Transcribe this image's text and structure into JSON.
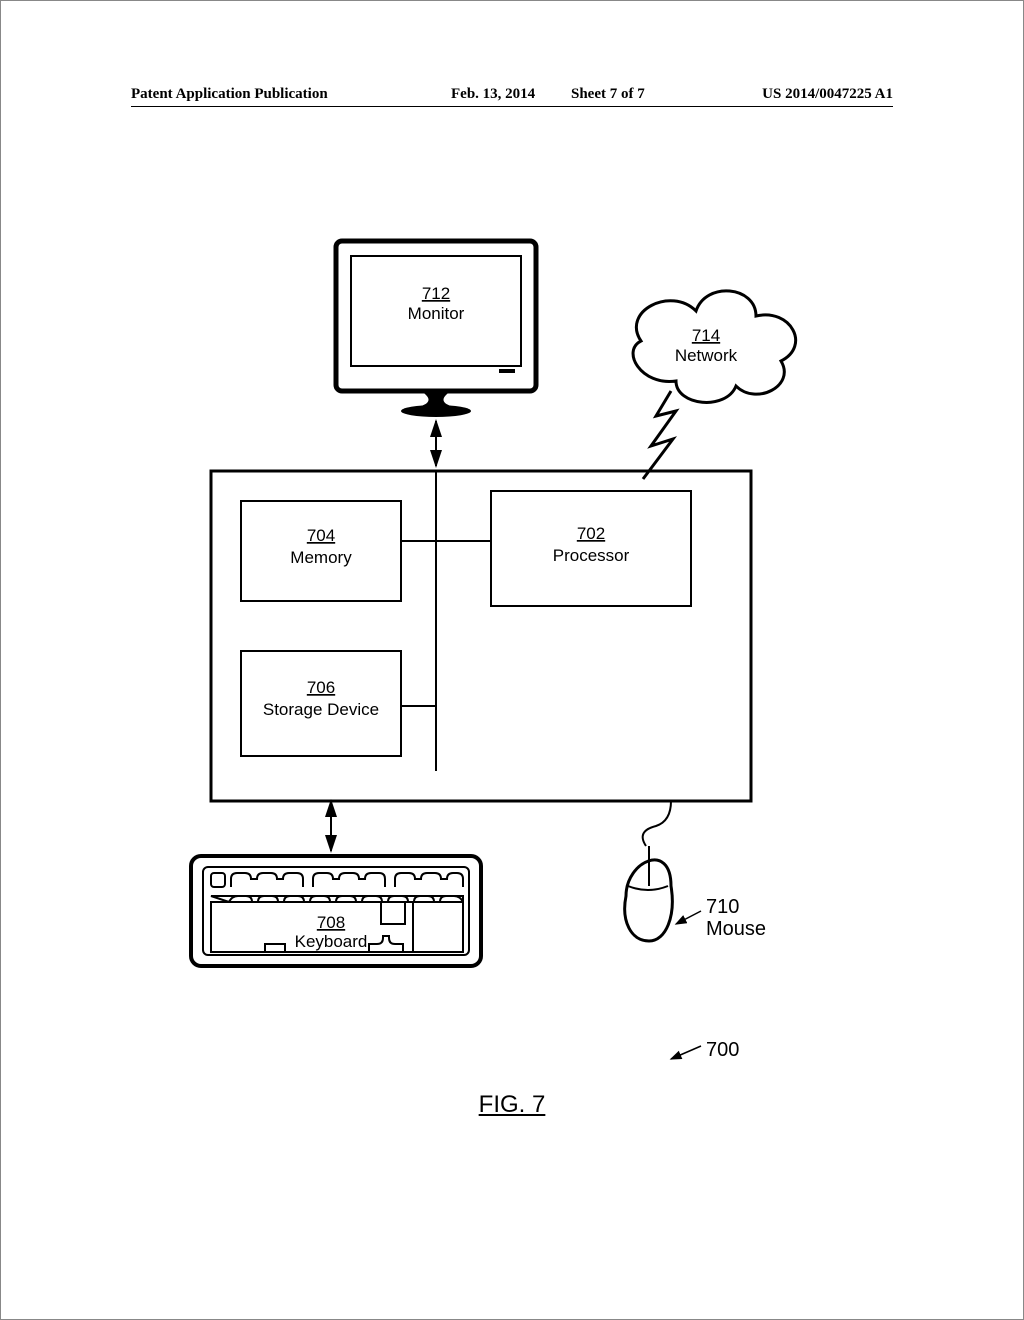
{
  "header": {
    "pub_type": "Patent Application Publication",
    "date": "Feb. 13, 2014",
    "sheet": "Sheet 7 of 7",
    "pubno": "US 2014/0047225 A1"
  },
  "figure": {
    "label": "FIG. 7",
    "overall_ref": "700"
  },
  "components": {
    "monitor": {
      "num": "712",
      "label": "Monitor"
    },
    "network": {
      "num": "714",
      "label": "Network"
    },
    "memory": {
      "num": "704",
      "label": "Memory"
    },
    "processor": {
      "num": "702",
      "label": "Processor"
    },
    "storage": {
      "num": "706",
      "label": "Storage Device"
    },
    "keyboard": {
      "num": "708",
      "label": "Keyboard"
    },
    "mouse": {
      "num": "710",
      "label": "Mouse"
    }
  }
}
